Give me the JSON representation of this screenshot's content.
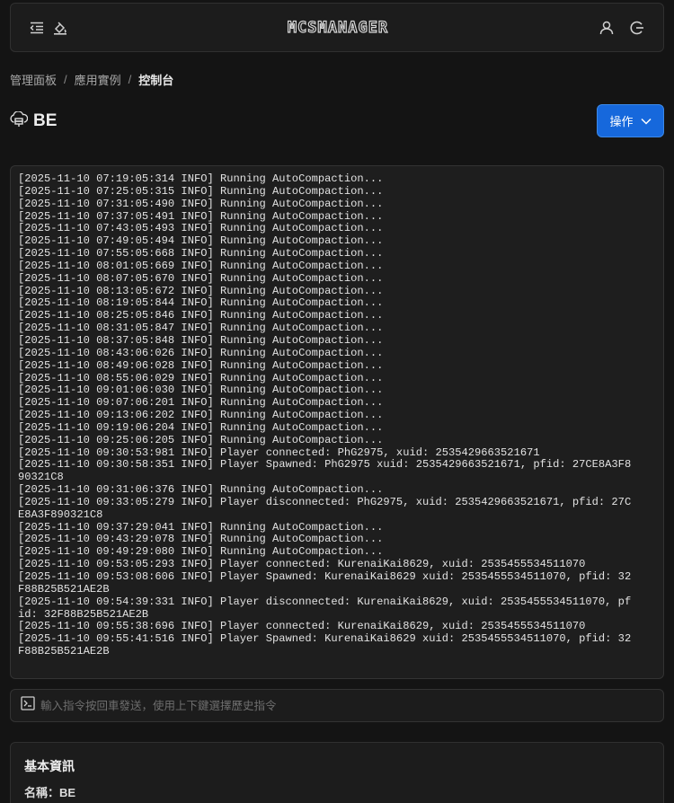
{
  "header": {
    "logo_text": "MCSMANAGER",
    "icons": [
      "menu-fold-icon",
      "theme-icon",
      "user-icon",
      "logout-icon"
    ]
  },
  "breadcrumb": [
    "管理面板",
    "應用實例",
    "控制台"
  ],
  "instance": {
    "name": "BE"
  },
  "actions": {
    "label": "操作"
  },
  "console": {
    "lines": [
      "[2025-11-10 07:19:05:314 INFO] Running AutoCompaction...",
      "[2025-11-10 07:25:05:315 INFO] Running AutoCompaction...",
      "[2025-11-10 07:31:05:490 INFO] Running AutoCompaction...",
      "[2025-11-10 07:37:05:491 INFO] Running AutoCompaction...",
      "[2025-11-10 07:43:05:493 INFO] Running AutoCompaction...",
      "[2025-11-10 07:49:05:494 INFO] Running AutoCompaction...",
      "[2025-11-10 07:55:05:668 INFO] Running AutoCompaction...",
      "[2025-11-10 08:01:05:669 INFO] Running AutoCompaction...",
      "[2025-11-10 08:07:05:670 INFO] Running AutoCompaction...",
      "[2025-11-10 08:13:05:672 INFO] Running AutoCompaction...",
      "[2025-11-10 08:19:05:844 INFO] Running AutoCompaction...",
      "[2025-11-10 08:25:05:846 INFO] Running AutoCompaction...",
      "[2025-11-10 08:31:05:847 INFO] Running AutoCompaction...",
      "[2025-11-10 08:37:05:848 INFO] Running AutoCompaction...",
      "[2025-11-10 08:43:06:026 INFO] Running AutoCompaction...",
      "[2025-11-10 08:49:06:028 INFO] Running AutoCompaction...",
      "[2025-11-10 08:55:06:029 INFO] Running AutoCompaction...",
      "[2025-11-10 09:01:06:030 INFO] Running AutoCompaction...",
      "[2025-11-10 09:07:06:201 INFO] Running AutoCompaction...",
      "[2025-11-10 09:13:06:202 INFO] Running AutoCompaction...",
      "[2025-11-10 09:19:06:204 INFO] Running AutoCompaction...",
      "[2025-11-10 09:25:06:205 INFO] Running AutoCompaction...",
      "[2025-11-10 09:30:53:981 INFO] Player connected: PhG2975, xuid: 2535429663521671",
      "[2025-11-10 09:30:58:351 INFO] Player Spawned: PhG2975 xuid: 2535429663521671, pfid: 27CE8A3F8",
      "90321C8",
      "[2025-11-10 09:31:06:376 INFO] Running AutoCompaction...",
      "[2025-11-10 09:33:05:279 INFO] Player disconnected: PhG2975, xuid: 2535429663521671, pfid: 27C",
      "E8A3F890321C8",
      "[2025-11-10 09:37:29:041 INFO] Running AutoCompaction...",
      "[2025-11-10 09:43:29:078 INFO] Running AutoCompaction...",
      "[2025-11-10 09:49:29:080 INFO] Running AutoCompaction...",
      "[2025-11-10 09:53:05:293 INFO] Player connected: KurenaiKai8629, xuid: 2535455534511070",
      "[2025-11-10 09:53:08:606 INFO] Player Spawned: KurenaiKai8629 xuid: 2535455534511070, pfid: 32",
      "F88B25B521AE2B",
      "[2025-11-10 09:54:39:331 INFO] Player disconnected: KurenaiKai8629, xuid: 2535455534511070, pf",
      "id: 32F88B25B521AE2B",
      "[2025-11-10 09:55:38:696 INFO] Player connected: KurenaiKai8629, xuid: 2535455534511070",
      "[2025-11-10 09:55:41:516 INFO] Player Spawned: KurenaiKai8629 xuid: 2535455534511070, pfid: 32",
      "F88B25B521AE2B"
    ]
  },
  "command": {
    "placeholder": "輸入指令按回車發送，使用上下鍵選擇歷史指令",
    "value": ""
  },
  "info_card": {
    "title": "基本資訊",
    "name_row": "名稱：BE"
  }
}
